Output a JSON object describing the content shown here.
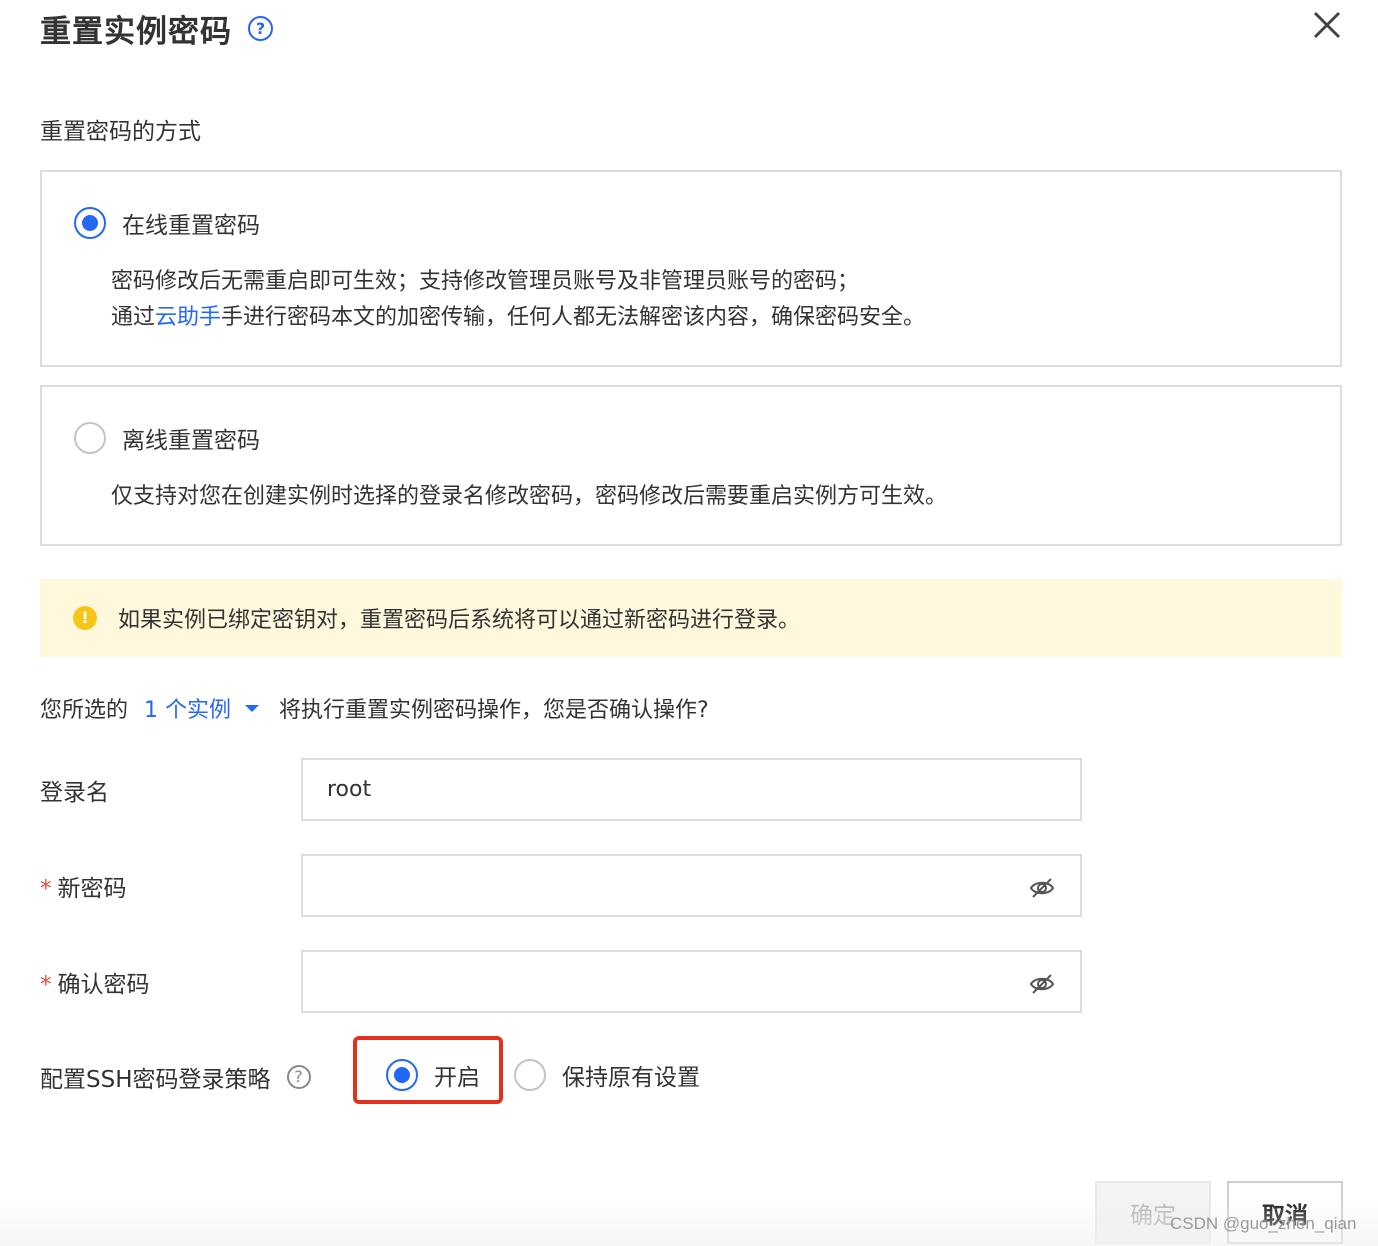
{
  "dialog": {
    "title": "重置实例密码",
    "help_symbol": "?"
  },
  "method": {
    "section_label": "重置密码的方式",
    "online": {
      "title": "在线重置密码",
      "selected": true,
      "desc_line1": "密码修改后无需重启即可生效；支持修改管理员账号及非管理员账号的密码；",
      "desc_line2_prefix": "通过",
      "desc_line2_link": "云助手",
      "desc_line2_suffix": "手进行密码本文的加密传输，任何人都无法解密该内容，确保密码安全。"
    },
    "offline": {
      "title": "离线重置密码",
      "selected": false,
      "desc": "仅支持对您在创建实例时选择的登录名修改密码，密码修改后需要重启实例方可生效。"
    }
  },
  "warning": {
    "icon_symbol": "!",
    "text": "如果实例已绑定密钥对，重置密码后系统将可以通过新密码进行登录。"
  },
  "confirm": {
    "prefix": "您所选的",
    "instance_link": "1 个实例",
    "suffix": "将执行重置实例密码操作，您是否确认操作?"
  },
  "form": {
    "login_label": "登录名",
    "login_value": "root",
    "required_mark": "*",
    "new_password_label": "新密码",
    "new_password_value": "",
    "confirm_password_label": "确认密码",
    "confirm_password_value": ""
  },
  "ssh": {
    "label": "配置SSH密码登录策略",
    "help_symbol": "?",
    "option_on": "开启",
    "option_keep": "保持原有设置",
    "selected": "开启"
  },
  "footer": {
    "ok_label": "确定",
    "cancel_label": "取消",
    "watermark": "CSDN @guo_zhen_qian"
  },
  "colors": {
    "accent": "#2468f2",
    "highlight": "#e0321e",
    "warning_bg": "#fff8dd",
    "warning_icon": "#f5c518",
    "required": "#e84a3b"
  }
}
